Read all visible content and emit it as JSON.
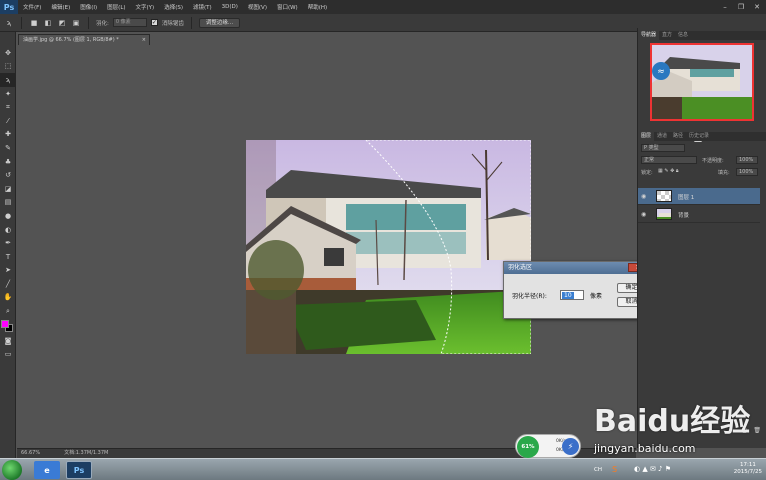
{
  "app": {
    "logo": "Ps"
  },
  "menu": [
    "文件(F)",
    "编辑(E)",
    "图像(I)",
    "图层(L)",
    "文字(Y)",
    "选择(S)",
    "滤镜(T)",
    "3D(D)",
    "视图(V)",
    "窗口(W)",
    "帮助(H)"
  ],
  "options": {
    "feather_label": "羽化:",
    "feather_value": "0 像素",
    "antialias_label": "消除锯齿",
    "refine_edge_button": "调整边缘..."
  },
  "document": {
    "tab_title": "油画学.jpg @ 66.7% (图层 1, RGB/8#) *",
    "zoom": "66.67%",
    "doc_size": "文档:1.37M/1.37M"
  },
  "dialog": {
    "title": "羽化选区",
    "radius_label": "羽化半径(R):",
    "radius_value": "10",
    "unit": "像素",
    "ok": "确定",
    "cancel": "取消",
    "close": "✕"
  },
  "panels": {
    "top_tabs": [
      "导航器",
      "直方",
      "信息"
    ],
    "layer_tabs": [
      "图层",
      "通道",
      "路径",
      "历史记录"
    ],
    "kind": "P 类型",
    "blend_mode": "正常",
    "opacity_label": "不透明度:",
    "opacity": "100%",
    "lock_label": "锁定:",
    "fill_label": "填充:",
    "fill": "100%",
    "layers": [
      {
        "name": "图层 1",
        "selected": true
      },
      {
        "name": "背景",
        "selected": false
      }
    ]
  },
  "widget": {
    "percent": "61%",
    "up": "0K/s",
    "down": "0K/s"
  },
  "taskbar": {
    "time": "17:11",
    "date": "2015/7/25",
    "tray_lang": "CH"
  },
  "watermark": {
    "brand": "Baidu经验",
    "url": "jingyan.baidu.com"
  },
  "colors": {
    "foreground": "#ff00ff",
    "background": "#000000",
    "selection_highlight": "#4a6a8d"
  }
}
